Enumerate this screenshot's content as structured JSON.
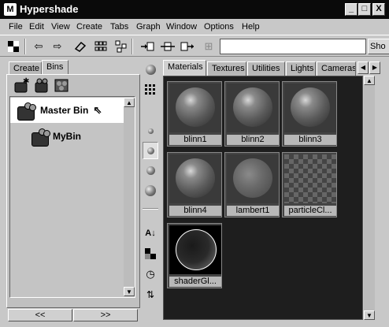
{
  "window": {
    "title": "Hypershade",
    "logo": "M",
    "minimize": "_",
    "maximize": "□",
    "close": "X"
  },
  "menubar": {
    "items": [
      "File",
      "Edit",
      "View",
      "Create",
      "Tabs",
      "Graph",
      "Window",
      "Options",
      "Help"
    ]
  },
  "toolbar": {
    "search_value": "",
    "sho_label": "Sho"
  },
  "left_panel": {
    "tabs": [
      "Create",
      "Bins"
    ],
    "active_tab": "Bins",
    "bins": [
      {
        "label": "Master Bin",
        "selected": true
      },
      {
        "label": "MyBin",
        "selected": false
      }
    ],
    "nav_left": "<<",
    "nav_right": ">>"
  },
  "right_panel": {
    "tabs": [
      "Materials",
      "Textures",
      "Utilities",
      "Lights",
      "Cameras"
    ],
    "active_tab": "Materials",
    "swatches": [
      {
        "label": "blinn1",
        "kind": "blinn"
      },
      {
        "label": "blinn2",
        "kind": "blinn"
      },
      {
        "label": "blinn3",
        "kind": "blinn"
      },
      {
        "label": "blinn4",
        "kind": "blinn"
      },
      {
        "label": "lambert1",
        "kind": "lambert"
      },
      {
        "label": "particleCl...",
        "kind": "particle"
      },
      {
        "label": "shaderGl...",
        "kind": "shader"
      }
    ]
  },
  "colors": {
    "title_bar": "#0a0a0a",
    "panel_bg": "#c8c8c8",
    "swatch_grid_bg": "#1e1e1e"
  }
}
